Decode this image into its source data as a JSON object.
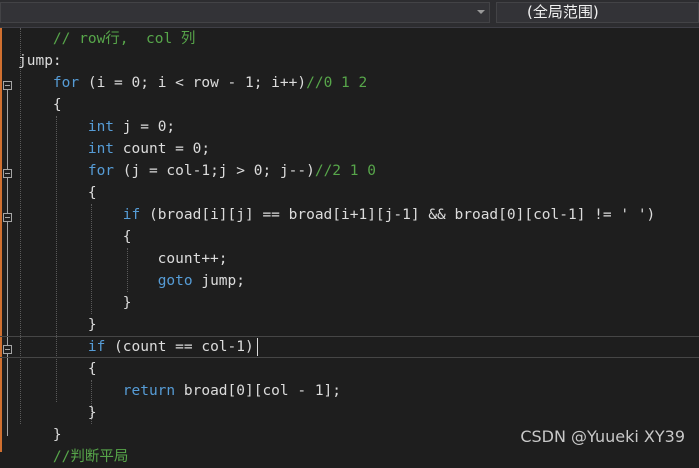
{
  "nav": {
    "left_value": "",
    "scope_value": "(全局范围)"
  },
  "code_lines": [
    {
      "tokens": [
        {
          "t": "    ",
          "c": "pl"
        },
        {
          "t": "// row行,  col 列",
          "c": "cm"
        }
      ]
    },
    {
      "tokens": [
        {
          "t": "jump:",
          "c": "pl"
        }
      ]
    },
    {
      "tokens": [
        {
          "t": "    ",
          "c": "pl"
        },
        {
          "t": "for",
          "c": "kw"
        },
        {
          "t": " (i = 0; i < row - 1; i++)",
          "c": "pl"
        },
        {
          "t": "//0 1 2",
          "c": "cm"
        }
      ]
    },
    {
      "tokens": [
        {
          "t": "    {",
          "c": "pl"
        }
      ]
    },
    {
      "tokens": [
        {
          "t": "        ",
          "c": "pl"
        },
        {
          "t": "int",
          "c": "kw"
        },
        {
          "t": " j = 0;",
          "c": "pl"
        }
      ]
    },
    {
      "tokens": [
        {
          "t": "        ",
          "c": "pl"
        },
        {
          "t": "int",
          "c": "kw"
        },
        {
          "t": " count = 0;",
          "c": "pl"
        }
      ]
    },
    {
      "tokens": [
        {
          "t": "        ",
          "c": "pl"
        },
        {
          "t": "for",
          "c": "kw"
        },
        {
          "t": " (j = col-1;j > 0; j--)",
          "c": "pl"
        },
        {
          "t": "//2 1 0",
          "c": "cm"
        }
      ]
    },
    {
      "tokens": [
        {
          "t": "        {",
          "c": "pl"
        }
      ]
    },
    {
      "tokens": [
        {
          "t": "            ",
          "c": "pl"
        },
        {
          "t": "if",
          "c": "kw"
        },
        {
          "t": " (broad[i][j] == broad[i+1][j-1] && broad[0][col-1] != ' ')",
          "c": "pl"
        }
      ]
    },
    {
      "tokens": [
        {
          "t": "            {",
          "c": "pl"
        }
      ]
    },
    {
      "tokens": [
        {
          "t": "                count++;",
          "c": "pl"
        }
      ]
    },
    {
      "tokens": [
        {
          "t": "                ",
          "c": "pl"
        },
        {
          "t": "goto",
          "c": "kw"
        },
        {
          "t": " jump;",
          "c": "pl"
        }
      ]
    },
    {
      "tokens": [
        {
          "t": "            }",
          "c": "pl"
        }
      ]
    },
    {
      "tokens": [
        {
          "t": "        }",
          "c": "pl"
        }
      ]
    },
    {
      "tokens": [
        {
          "t": "        ",
          "c": "pl"
        },
        {
          "t": "if",
          "c": "kw"
        },
        {
          "t": " (count == col-1)",
          "c": "pl"
        }
      ]
    },
    {
      "tokens": [
        {
          "t": "        {",
          "c": "pl"
        }
      ]
    },
    {
      "tokens": [
        {
          "t": "            ",
          "c": "pl"
        },
        {
          "t": "return",
          "c": "kw"
        },
        {
          "t": " broad[0][col - 1];",
          "c": "pl"
        }
      ]
    },
    {
      "tokens": [
        {
          "t": "        }",
          "c": "pl"
        }
      ]
    },
    {
      "tokens": [
        {
          "t": "    }",
          "c": "pl"
        }
      ]
    },
    {
      "tokens": [
        {
          "t": "    ",
          "c": "pl"
        },
        {
          "t": "//判断平局",
          "c": "cm"
        }
      ]
    }
  ],
  "watermark": "CSDN @Yuueki XY39"
}
